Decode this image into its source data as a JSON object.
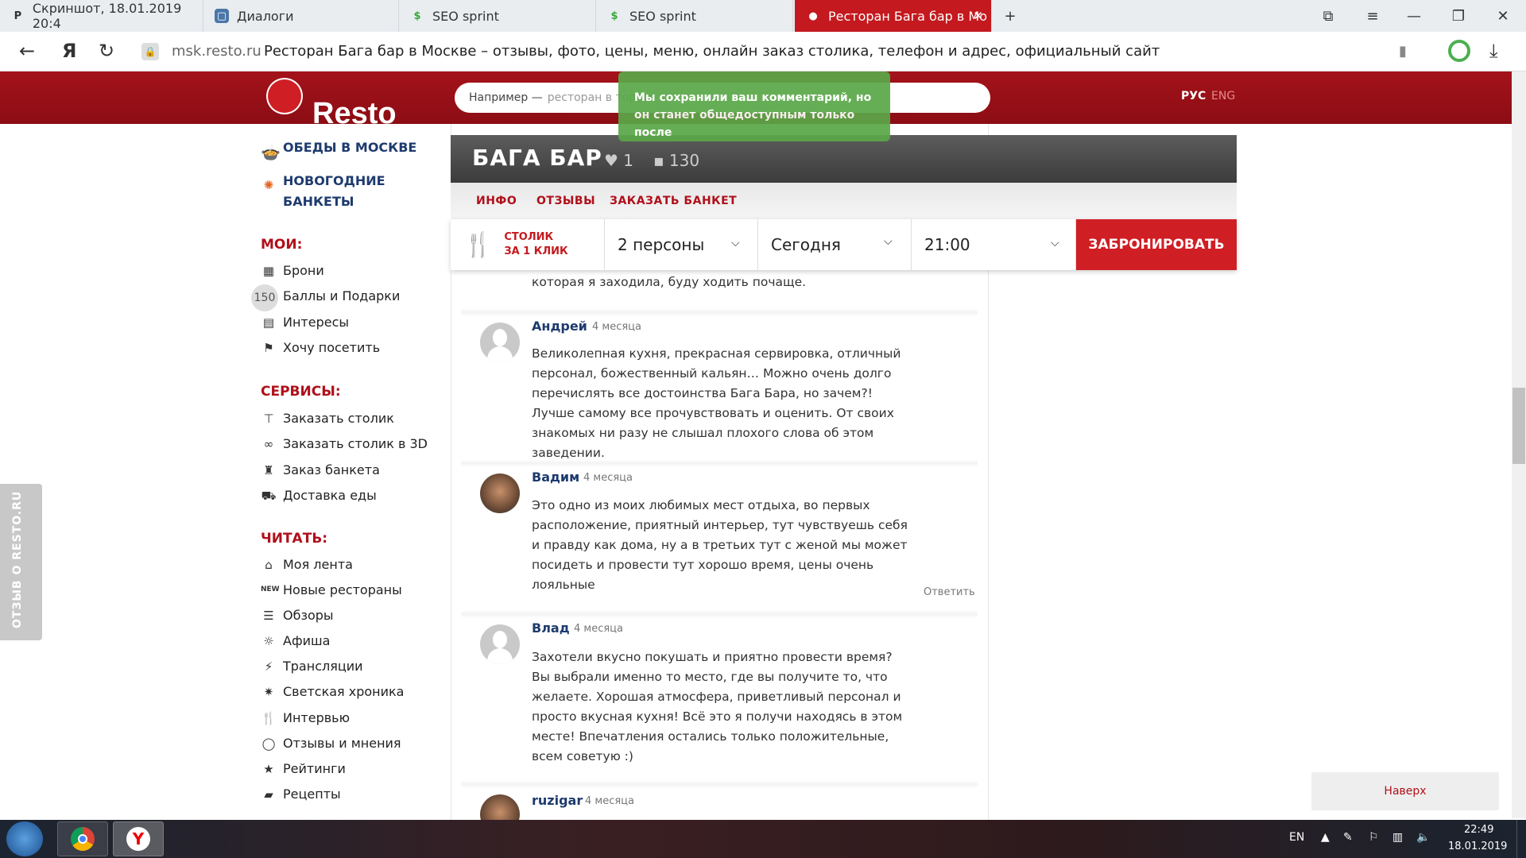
{
  "browser": {
    "tabs": [
      {
        "title": "Скриншот, 18.01.2019 20:4",
        "icon": "P"
      },
      {
        "title": "Диалоги",
        "icon": "vk"
      },
      {
        "title": "SEO sprint",
        "icon": "S"
      },
      {
        "title": "SEO sprint",
        "icon": "S"
      },
      {
        "title": "Ресторан Бага бар в Мо",
        "icon": "resto"
      }
    ],
    "url_host": "msk.resto.ru",
    "url_title": "Ресторан Бага бар в Москве – отзывы, фото, цены, меню, онлайн заказ столика, телефон и адрес, официальный сайт"
  },
  "header": {
    "logo": "Resto",
    "search_prefix": "Например —",
    "search_placeholder": "ресторан в торгов",
    "lang_ru": "РУС",
    "lang_en": "ENG"
  },
  "toast": "Мы сохранили ваш комментарий, но он станет общедоступным только после",
  "sidebar": {
    "promo": [
      "ОБЕДЫ В МОСКВЕ",
      "НОВОГОДНИЕ",
      "БАНКЕТЫ"
    ],
    "mine_title": "МОИ:",
    "mine": [
      "Брони",
      "Баллы и Подарки",
      "Интересы",
      "Хочу посетить"
    ],
    "points_badge": "150",
    "services_title": "СЕРВИСЫ:",
    "services": [
      "Заказать столик",
      "Заказать столик в 3D",
      "Заказ банкета",
      "Доставка еды"
    ],
    "read_title": "ЧИТАТЬ:",
    "read_new_badge": "NEW",
    "read": [
      "Моя лента",
      "Новые рестораны",
      "Обзоры",
      "Афиша",
      "Трансляции",
      "Светская хроника",
      "Интервью",
      "Отзывы и мнения",
      "Рейтинги",
      "Рецепты"
    ]
  },
  "restaurant": {
    "name": "БАГА БАР",
    "likes": "1",
    "comments": "130",
    "tabs": [
      "ИНФО",
      "ОТЗЫВЫ",
      "ЗАКАЗАТЬ БАНКЕТ"
    ]
  },
  "booking": {
    "label1": "СТОЛИК",
    "label2": "ЗА 1 КЛИК",
    "persons": "2 персоны",
    "day": "Сегодня",
    "time": "21:00",
    "button": "ЗАБРОНИРОВАТЬ"
  },
  "reviews": {
    "prev_tail": "которая я заходила, буду ходить почаще.",
    "items": [
      {
        "name": "Андрей",
        "time": "4 месяца",
        "text": "Великолепная кухня, прекрасная сервировка, отличный персонал, божественный кальян… Можно очень долго перечислять все достоинства Бага Бара, но зачем?! Лучше самому все прочувствовать и оценить. От своих знакомых ни разу не слышал плохого слова об этом заведении."
      },
      {
        "name": "Вадим",
        "time": "4 месяца",
        "text": "Это одно из моих любимых мест отдыха, во первых расположение, приятный интерьер, тут чувствуешь себя и правду как дома, ну а в третьих тут с женой мы может посидеть и провести тут хорошо время, цены очень лояльные"
      },
      {
        "name": "Влад",
        "time": "4 месяца",
        "text": "Захотели вкусно покушать и приятно провести время? Вы выбрали именно то место, где вы получите то, что желаете. Хорошая атмосфера, приветливый персонал и просто вкусная кухня! Всё это я получи находясь в этом месте! Впечатления остались только положительные, всем советую :)"
      },
      {
        "name": "ruzigar",
        "time": "4 месяца",
        "text": ""
      }
    ],
    "reply_label": "Ответить"
  },
  "feedback_tab": "ОТЗЫВ О RESTO.RU",
  "top_button": "Наверх",
  "taskbar": {
    "lang": "EN",
    "time": "22:49",
    "date": "18.01.2019"
  }
}
